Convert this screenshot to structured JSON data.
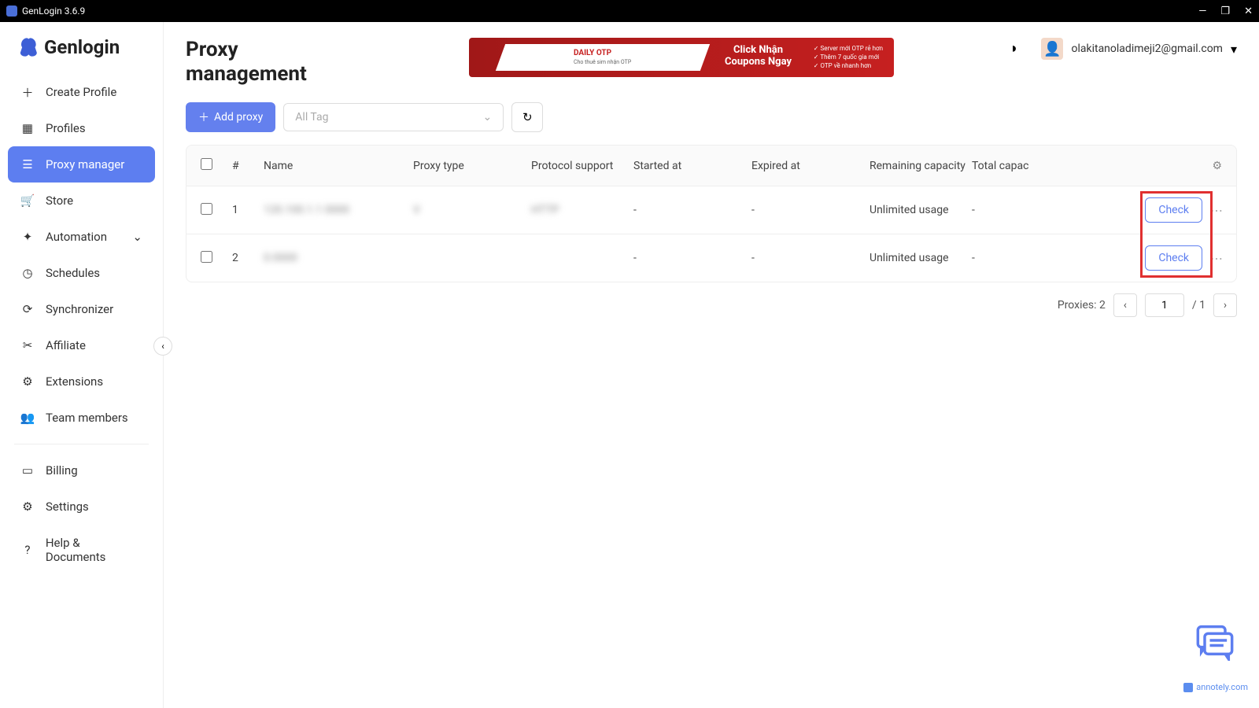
{
  "titlebar": {
    "title": "GenLogin 3.6.9"
  },
  "logo": {
    "text": "Genlogin"
  },
  "sidebar": {
    "items": [
      {
        "label": "Create Profile"
      },
      {
        "label": "Profiles"
      },
      {
        "label": "Proxy manager"
      },
      {
        "label": "Store"
      },
      {
        "label": "Automation"
      },
      {
        "label": "Schedules"
      },
      {
        "label": "Synchronizer"
      },
      {
        "label": "Affiliate"
      },
      {
        "label": "Extensions"
      },
      {
        "label": "Team members"
      },
      {
        "label": "Billing"
      },
      {
        "label": "Settings"
      },
      {
        "label": "Help & Documents"
      }
    ]
  },
  "header": {
    "title": "Proxy management",
    "banner": {
      "brand": "DAILY OTP",
      "sub": "Cho thuê sim nhận OTP",
      "cta1": "Click Nhận",
      "cta2": "Coupons Ngay",
      "line1": "✓ Server mới OTP rẻ hơn",
      "line2": "✓ Thêm 7 quốc gia mới",
      "line3": "✓ OTP về nhanh hơn"
    },
    "user": {
      "email": "olakitanoladimeji2@gmail.com"
    }
  },
  "toolbar": {
    "add_label": "Add proxy",
    "tag_placeholder": "All Tag"
  },
  "table": {
    "headers": {
      "num": "#",
      "name": "Name",
      "type": "Proxy type",
      "protocol": "Protocol support",
      "started": "Started at",
      "expired": "Expired at",
      "remaining": "Remaining capacity",
      "total": "Total capac"
    },
    "rows": [
      {
        "num": "1",
        "name": "120.100.1.1 0000",
        "type": "V",
        "protocol": "HTTP",
        "started": "-",
        "expired": "-",
        "remaining": "Unlimited usage",
        "total": "-",
        "action": "Check"
      },
      {
        "num": "2",
        "name": "0.0000",
        "type": "",
        "protocol": "",
        "started": "-",
        "expired": "-",
        "remaining": "Unlimited usage",
        "total": "-",
        "action": "Check"
      }
    ]
  },
  "pagination": {
    "summary": "Proxies: 2",
    "page": "1",
    "total": "/ 1"
  },
  "annotely": {
    "text": "annotely.com"
  }
}
